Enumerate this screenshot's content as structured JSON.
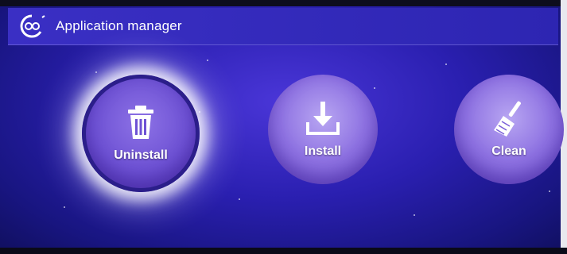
{
  "header": {
    "title": "Application manager",
    "logo_icon": "cc-logo-icon"
  },
  "actions": [
    {
      "label": "Uninstall",
      "icon": "trash-icon",
      "selected": true
    },
    {
      "label": "Install",
      "icon": "download-icon",
      "selected": false
    },
    {
      "label": "Clean",
      "icon": "broom-icon",
      "selected": false
    }
  ],
  "colors": {
    "background": "#2a1fb0",
    "header": "#3a2fc4",
    "button": "#8e72e2",
    "selected_ring": "#2b1e8a"
  }
}
